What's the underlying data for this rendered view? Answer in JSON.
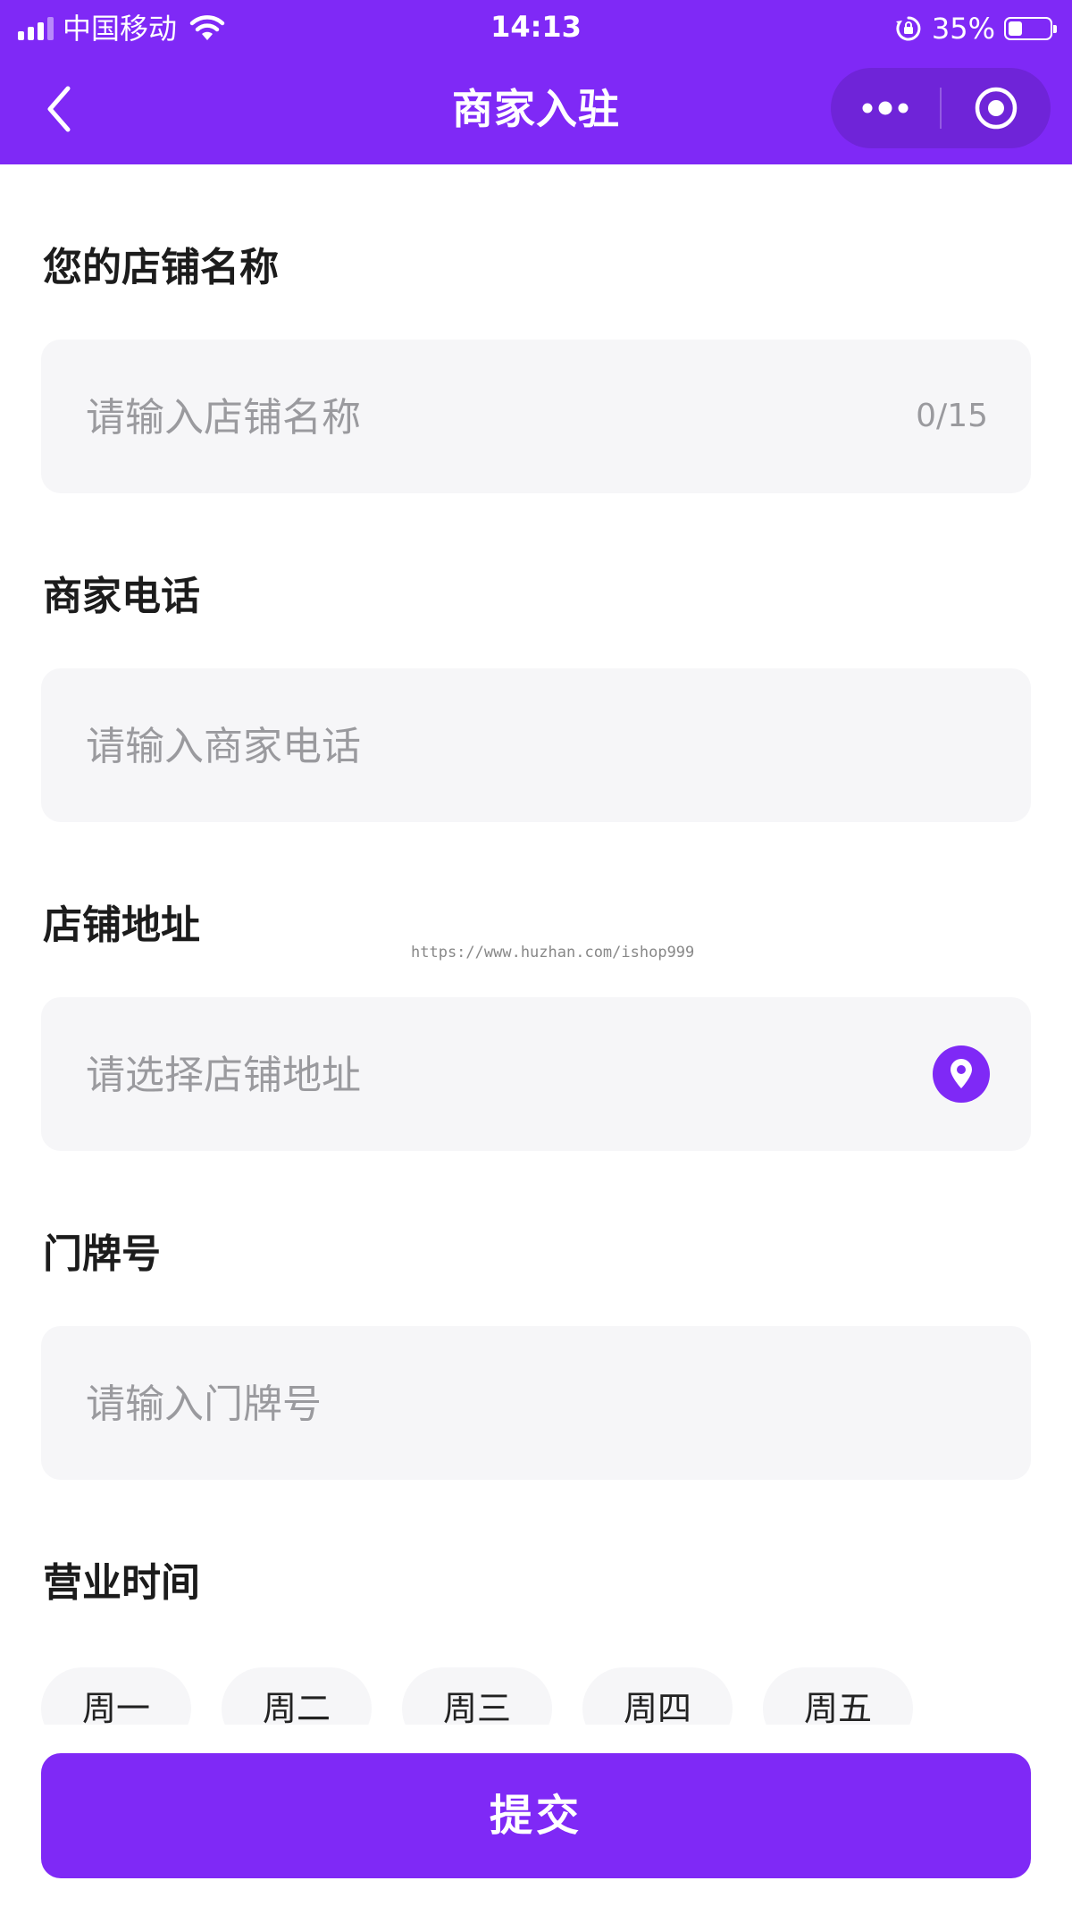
{
  "status_bar": {
    "carrier": "中国移动",
    "time": "14:13",
    "battery_percent": "35%",
    "battery_level": 0.35,
    "icons": [
      "signal-icon",
      "wifi-icon",
      "rotation-lock-icon",
      "battery-icon"
    ]
  },
  "nav": {
    "title": "商家入驻",
    "back_icon": "chevron-left-icon",
    "more_icon": "more-dots-icon",
    "close_icon": "target-circle-icon"
  },
  "form": {
    "shop_name": {
      "label": "您的店铺名称",
      "placeholder": "请输入店铺名称",
      "counter": "0/15"
    },
    "phone": {
      "label": "商家电话",
      "placeholder": "请输入商家电话"
    },
    "address": {
      "label": "店铺地址",
      "placeholder": "请选择店铺地址",
      "icon": "location-pin-icon"
    },
    "door_number": {
      "label": "门牌号",
      "placeholder": "请输入门牌号"
    },
    "business_hours": {
      "label": "营业时间",
      "days": [
        "周一",
        "周二",
        "周三",
        "周四",
        "周五"
      ]
    }
  },
  "watermark": "https://www.huzhan.com/ishop999",
  "submit_label": "提交",
  "colors": {
    "accent": "#7f29f6",
    "input_bg": "#f6f6f8",
    "placeholder": "#9a9a9e"
  }
}
